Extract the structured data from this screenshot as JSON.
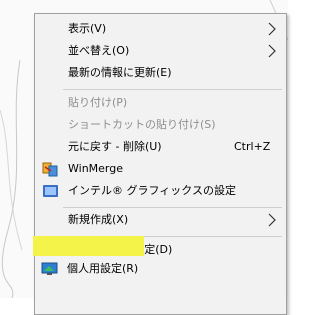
{
  "context_menu": {
    "items": [
      {
        "label": "表示(V)",
        "has_submenu": true
      },
      {
        "label": "並べ替え(O)",
        "has_submenu": true
      },
      {
        "label": "最新の情報に更新(E)"
      },
      {
        "label": "貼り付け(P)",
        "disabled": true
      },
      {
        "label": "ショートカットの貼り付け(S)",
        "disabled": true
      },
      {
        "label": "元に戻す - 削除(U)",
        "shortcut": "Ctrl+Z"
      },
      {
        "label": "WinMerge",
        "icon": "winmerge-icon"
      },
      {
        "label": "インテル® グラフィックスの設定",
        "icon": "intel-graphics-icon"
      },
      {
        "label": "新規作成(X)",
        "has_submenu": true
      },
      {
        "label": "ディスプレイ設定(D)",
        "icon": "display-icon"
      },
      {
        "label": "個人用設定(R)",
        "icon": "personalize-icon"
      }
    ]
  },
  "colors": {
    "menu_background": "#f2f2f2",
    "disabled_text": "#8e8e8e",
    "highlight": "#f3f34a"
  }
}
